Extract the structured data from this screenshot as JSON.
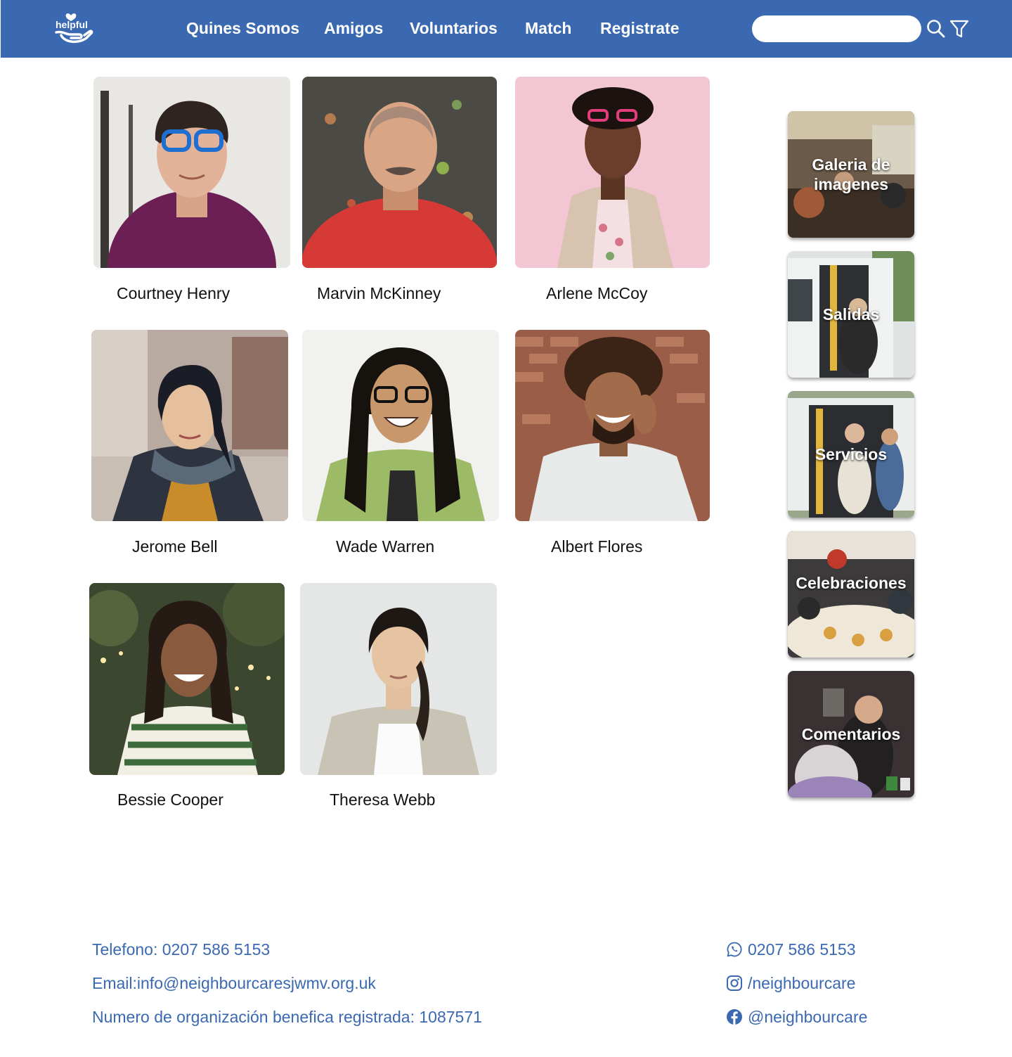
{
  "brand": {
    "logo_text": "helpful"
  },
  "nav": {
    "items": [
      {
        "label": "Quines Somos"
      },
      {
        "label": "Amigos"
      },
      {
        "label": "Voluntarios"
      },
      {
        "label": "Match"
      },
      {
        "label": "Registrate"
      }
    ]
  },
  "search": {
    "placeholder": "",
    "value": ""
  },
  "people": [
    {
      "name": "Courtney Henry"
    },
    {
      "name": "Marvin McKinney"
    },
    {
      "name": "Arlene McCoy"
    },
    {
      "name": "Jerome Bell"
    },
    {
      "name": "Wade Warren"
    },
    {
      "name": "Albert Flores"
    },
    {
      "name": "Bessie Cooper"
    },
    {
      "name": "Theresa Webb"
    }
  ],
  "side_tiles": [
    {
      "label_line1": "Galeria de",
      "label_line2": "imagenes"
    },
    {
      "label_line1": "Salidas",
      "label_line2": ""
    },
    {
      "label_line1": "Servicios",
      "label_line2": ""
    },
    {
      "label_line1": "Celebraciones",
      "label_line2": ""
    },
    {
      "label_line1": "Comentarios",
      "label_line2": ""
    }
  ],
  "footer": {
    "phone": "Telefono: 0207 586 5153",
    "email": "Email:info@neighbourcaresjwmv.org.uk",
    "charity": "Numero de organización benefica registrada: 1087571",
    "whatsapp": "0207 586 5153",
    "instagram": "/neighbourcare",
    "facebook": "@neighbourcare"
  },
  "colors": {
    "brand_blue": "#3a69b2",
    "text": "#111111",
    "white": "#ffffff"
  }
}
